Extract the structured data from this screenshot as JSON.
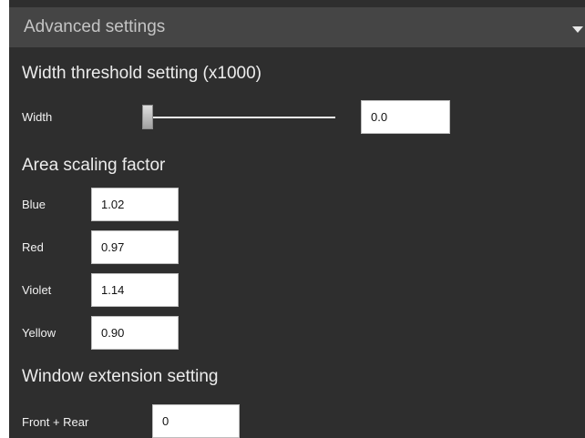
{
  "panel": {
    "title": "Advanced settings",
    "collapse_icon": "chevron-down-icon"
  },
  "width_threshold": {
    "title": "Width threshold setting (x1000)",
    "label": "Width",
    "slider_fraction": 0,
    "value": "0.0"
  },
  "area_scaling": {
    "title": "Area scaling factor",
    "rows": [
      {
        "label": "Blue",
        "value": "1.02"
      },
      {
        "label": "Red",
        "value": "0.97"
      },
      {
        "label": "Violet",
        "value": "1.14"
      },
      {
        "label": "Yellow",
        "value": "0.90"
      }
    ]
  },
  "window_extension": {
    "title": "Window extension setting",
    "label": "Front + Rear",
    "value": "0"
  },
  "colors": {
    "panel_bg": "#2e2e2e",
    "header_bg": "#454545",
    "text": "#f2f2f2"
  }
}
